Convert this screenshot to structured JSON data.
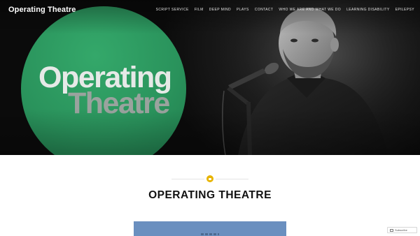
{
  "header": {
    "site_title": "Operating Theatre",
    "logo_line_1": "Operating",
    "logo_line_2": "Theatre",
    "nav_items": [
      "SCRIPT SERVICE",
      "FILM",
      "DEEP MIND",
      "PLAYS",
      "CONTACT",
      "WHO WE ARE AND WHAT WE DO",
      "LEARNING DISABILITY",
      "EPILEPSY"
    ]
  },
  "main": {
    "page_title": "OPERATING THEATRE",
    "badge_icon": "document-icon",
    "badge_color": "#e8b400",
    "content_block_color": "#6a8fbf"
  },
  "footer": {
    "subscribe_label": "Subscribe",
    "subscribe_icon": "subscribe-icon"
  },
  "colors": {
    "logo_green": "#2a935c",
    "page_background": "#ffffff",
    "title_text": "#111111"
  }
}
